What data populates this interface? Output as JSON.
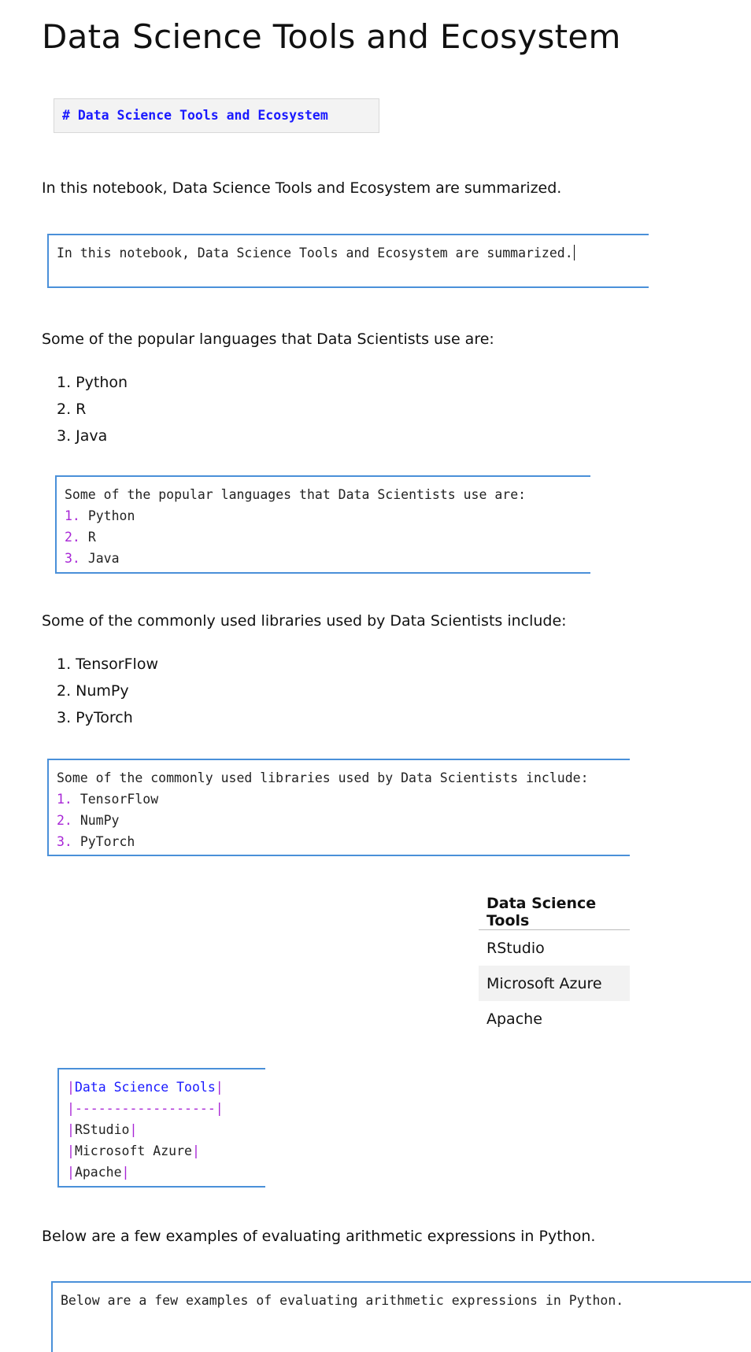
{
  "title": "Data Science Tools and Ecosystem",
  "title_source": "# Data Science Tools and Ecosystem",
  "intro": {
    "rendered": "In this notebook, Data Science Tools and Ecosystem are summarized.",
    "source": "In this notebook, Data Science Tools and Ecosystem are summarized."
  },
  "languages": {
    "heading": "Some of the popular languages that Data Scientists use are:",
    "items": [
      "Python",
      "R",
      "Java"
    ],
    "numbers": [
      "1.",
      "2.",
      "3."
    ]
  },
  "libraries": {
    "heading": "Some of the commonly used libraries used by Data Scientists include:",
    "items": [
      "TensorFlow",
      "NumPy",
      "PyTorch"
    ],
    "numbers": [
      "1.",
      "2.",
      "3."
    ]
  },
  "tools_table": {
    "header": "Data Science Tools",
    "rows": [
      "RStudio",
      "Microsoft Azure",
      "Apache"
    ],
    "separator": "------------------"
  },
  "arith": {
    "rendered": "Below are a few examples of evaluating arithmetic expressions in Python.",
    "source": "Below are a few examples of evaluating arithmetic expressions in Python."
  },
  "colors": {
    "cell_border": "#4a90d9",
    "list_number": "#a826d6",
    "markdown_header": "#1a1aff"
  }
}
